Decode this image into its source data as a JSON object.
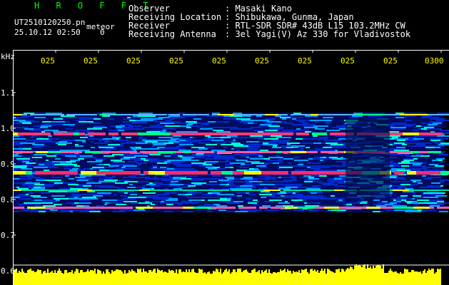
{
  "header": {
    "app_name": "H R O F F T",
    "filename": "UT2510120250.pn",
    "meteor_label": "meteor",
    "datetime": "25.10.12 02:50",
    "count": "0",
    "info": [
      {
        "label": "Observer",
        "value": ": Masaki Kano"
      },
      {
        "label": "Receiving Location",
        "value": ": Shibukawa, Gunma, Japan"
      },
      {
        "label": "Receiver",
        "value": ": RTL-SDR SDR# 43dB L15 103.2MHz CW"
      },
      {
        "label": "Receiving Antenna",
        "value": ": 3el Yagi(V) Az 330 for Vladivostok"
      }
    ]
  },
  "spectrogram": {
    "y_unit": "kHz",
    "y_ticks": [
      "1.1",
      "1.0",
      "0.9",
      "0.8",
      "0.7",
      "0.6"
    ],
    "x_ticks": [
      "025",
      "025",
      "025",
      "025",
      "025",
      "025",
      "025",
      "025",
      "025",
      "0300"
    ],
    "colors": {
      "frame": "#ffffff",
      "tick_text": "#ffff00",
      "power_bar": "#ffff00",
      "background": "#000000"
    }
  }
}
